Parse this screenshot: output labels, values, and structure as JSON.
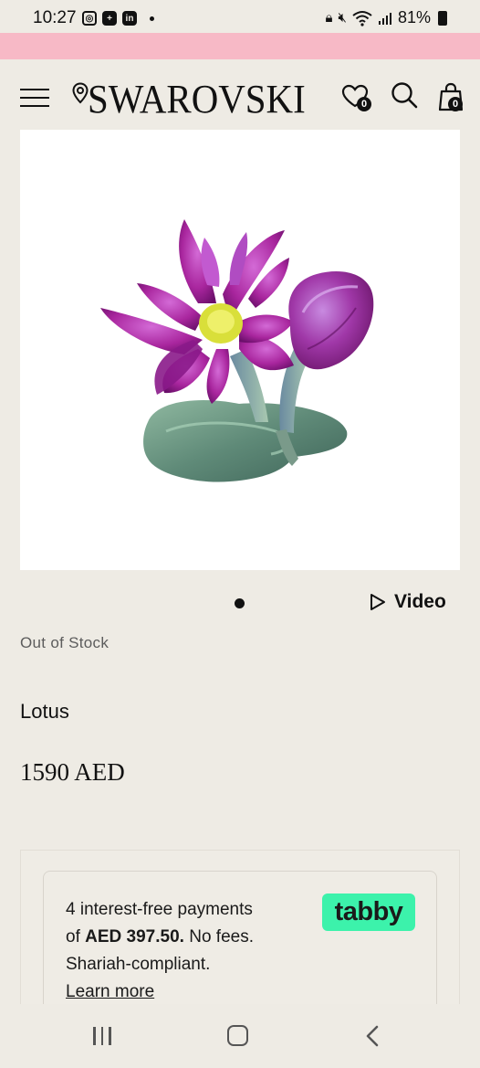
{
  "status": {
    "time": "10:27",
    "battery": "81%"
  },
  "header": {
    "logo": "SWAROVSKI",
    "wishlist_count": "0",
    "bag_count": "0"
  },
  "product": {
    "video_label": "Video",
    "stock_status": "Out of Stock",
    "name": "Lotus",
    "price": "1590 AED"
  },
  "tabby": {
    "line1": "4 interest-free payments",
    "line2_prefix": "of",
    "line2_amount": "AED 397.50.",
    "line2_suffix": "No fees.",
    "line3": "Shariah-compliant.",
    "learn_more": "Learn more",
    "logo": "tabby"
  },
  "colors": {
    "promo_bar": "#f7b9c6",
    "background": "#eeebe4",
    "tabby_green": "#3cf2ab"
  }
}
